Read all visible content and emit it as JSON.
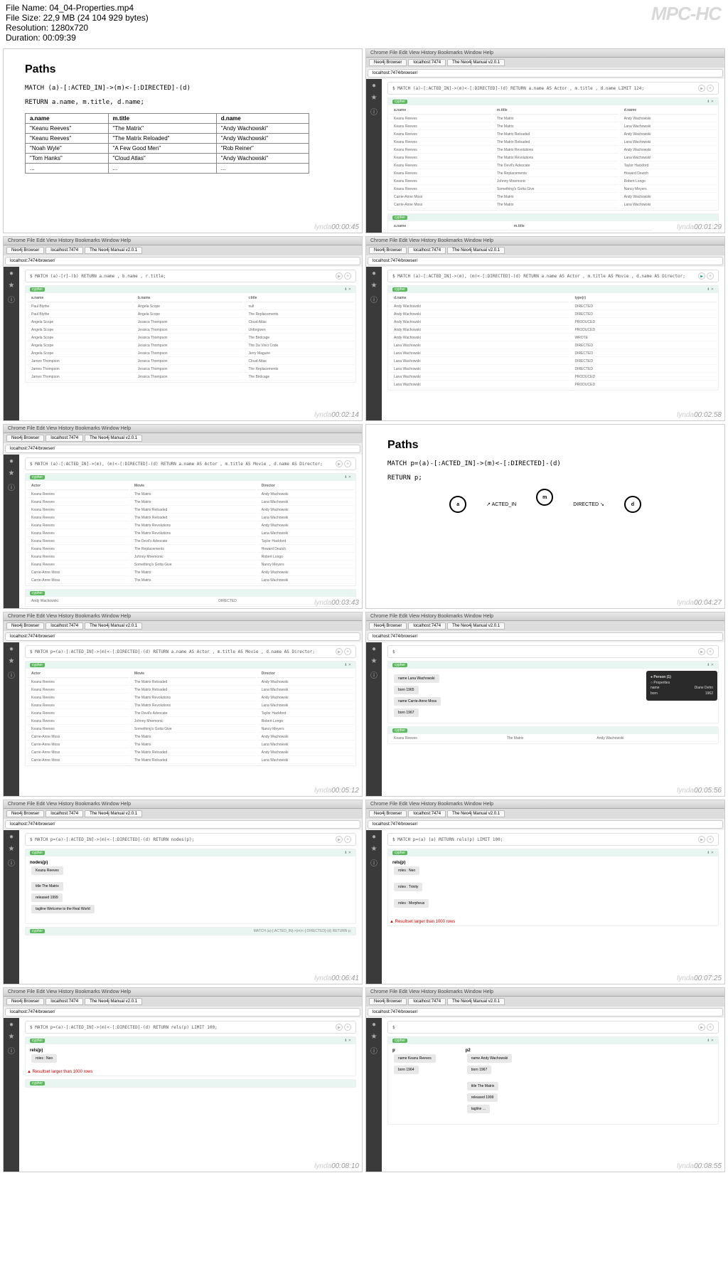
{
  "header": {
    "file": "File Name: 04_04-Properties.mp4",
    "size": "File Size: 22,9 MB (24 104 929 bytes)",
    "res": "Resolution: 1280x720",
    "dur": "Duration: 00:09:39",
    "mpc": "MPC-HC"
  },
  "menu": "Chrome  File  Edit  View  History  Bookmarks  Window  Help",
  "tabs": [
    "Neo4j Browser",
    "localhost:7474",
    "The Neo4j Manual v2.0.1"
  ],
  "url": "localhost:7474/browser/",
  "lynda": "lynda",
  "slide1": {
    "title": "Paths",
    "code1": "MATCH (a)-[:ACTED_IN]->(m)<-[:DIRECTED]-(d)",
    "code2": "RETURN a.name, m.title, d.name;",
    "headers": [
      "a.name",
      "m.title",
      "d.name"
    ],
    "rows": [
      [
        "\"Keanu Reeves\"",
        "\"The Matrix\"",
        "\"Andy Wachowski\""
      ],
      [
        "\"Keanu Reeves\"",
        "\"The Matrix Reloaded\"",
        "\"Andy Wachowski\""
      ],
      [
        "\"Noah Wyle\"",
        "\"A Few Good Men\"",
        "\"Rob Reiner\""
      ],
      [
        "\"Tom Hanks\"",
        "\"Cloud Atlas\"",
        "\"Andy Wachowski\""
      ],
      [
        "...",
        "...",
        "..."
      ]
    ]
  },
  "slide6": {
    "title": "Paths",
    "code1": "MATCH p=(a)-[:ACTED_IN]->(m)<-[:DIRECTED]-(d)",
    "code2": "RETURN p;",
    "nodes": [
      "a",
      "m",
      "d"
    ],
    "edges": [
      "ACTED_IN",
      "DIRECTED"
    ]
  },
  "q2": "$ MATCH (a)-[:ACTED_IN]->(m)<-[:DIRECTED]-(d) RETURN a.name AS Actor , m.title , d.name LIMIT 124;",
  "q3": "$ MATCH (a)-[r]-(b) RETURN a.name , b.name , r.title;",
  "q4": "$ MATCH (a)-[:ACTED_IN]->(m), (m)<-[:DIRECTED]-(d) RETURN a.name AS Actor , m.title AS Movie , d.name AS Director;",
  "q5": "$ MATCH (a)-[:ACTED_IN]->(m), (m)<-[:DIRECTED]-(d) RETURN a.name AS Actor , m.title AS Movie , d.name AS Director;",
  "q7": "$ MATCH p=(a)-[:ACTED_IN]->(m)<-[:DIRECTED]-(d) RETURN a.name AS Actor , m.title AS Movie , d.name AS Director;",
  "q8": "$",
  "q9": "$ MATCH p=(a)-[:ACTED_IN]->(m)<-[:DIRECTED]-(d) RETURN nodes(p);",
  "q10": "$ MATCH p=(a)   (a)  RETURN rels(p) LIMIT 100;",
  "q11": "$ MATCH p=(a)-[:ACTED_IN]->(m)<-[:DIRECTED]-(d) RETURN rels(p) LIMIT 100;",
  "q12": "$",
  "r2h": [
    "a.name",
    "m.title",
    "d.name"
  ],
  "r2": [
    [
      "Keanu Reeves",
      "The Matrix",
      "Andy Wachowski"
    ],
    [
      "Keanu Reeves",
      "The Matrix",
      "Lana Wachowski"
    ],
    [
      "Keanu Reeves",
      "The Matrix Reloaded",
      "Andy Wachowski"
    ],
    [
      "Keanu Reeves",
      "The Matrix Reloaded",
      "Lana Wachowski"
    ],
    [
      "Keanu Reeves",
      "The Matrix Revolutions",
      "Andy Wachowski"
    ],
    [
      "Keanu Reeves",
      "The Matrix Revolutions",
      "Lana Wachowski"
    ],
    [
      "Keanu Reeves",
      "The Devil's Advocate",
      "Taylor Hackford"
    ],
    [
      "Keanu Reeves",
      "The Replacements",
      "Howard Deutch"
    ],
    [
      "Keanu Reeves",
      "Johnny Mnemonic",
      "Robert Longo"
    ],
    [
      "Keanu Reeves",
      "Something's Gotta Give",
      "Nancy Meyers"
    ],
    [
      "Carrie-Anne Moss",
      "The Matrix",
      "Andy Wachowski"
    ],
    [
      "Carrie-Anne Moss",
      "The Matrix",
      "Lana Wachowski"
    ]
  ],
  "r3h": [
    "a.name",
    "b.name",
    "r.title"
  ],
  "r3": [
    [
      "Paul Blythe",
      "Angela Scope",
      "null"
    ],
    [
      "Paul Blythe",
      "Angela Scope",
      "The Replacements"
    ],
    [
      "Angela Scope",
      "Jessica Thompson",
      "Cloud Atlas"
    ],
    [
      "Angela Scope",
      "Jessica Thompson",
      "Unforgiven"
    ],
    [
      "Angela Scope",
      "Jessica Thompson",
      "The Birdcage"
    ],
    [
      "Angela Scope",
      "Jessica Thompson",
      "The Da Vinci Code"
    ],
    [
      "Angela Scope",
      "Jessica Thompson",
      "Jerry Maguire"
    ],
    [
      "James Thompson",
      "Jessica Thompson",
      "Cloud Atlas"
    ],
    [
      "James Thompson",
      "Jessica Thompson",
      "The Replacements"
    ],
    [
      "James Thompson",
      "Jessica Thompson",
      "The Birdcage"
    ]
  ],
  "r4h": [
    "d.name",
    "type(r)"
  ],
  "r4": [
    [
      "Andy Wachowski",
      "DIRECTED"
    ],
    [
      "Andy Wachowski",
      "DIRECTED"
    ],
    [
      "Andy Wachowski",
      "PRODUCED"
    ],
    [
      "Andy Wachowski",
      "PRODUCED"
    ],
    [
      "Andy Wachowski",
      "WROTE"
    ],
    [
      "Lana Wachowski",
      "DIRECTED"
    ],
    [
      "Lana Wachowski",
      "DIRECTED"
    ],
    [
      "Lana Wachowski",
      "DIRECTED"
    ],
    [
      "Lana Wachowski",
      "DIRECTED"
    ],
    [
      "Lana Wachowski",
      "PRODUCED"
    ],
    [
      "Lana Wachowski",
      "PRODUCED"
    ]
  ],
  "r5h": [
    "Actor",
    "Movie",
    "Director"
  ],
  "r5": [
    [
      "Keanu Reeves",
      "The Matrix",
      "Andy Wachowski"
    ],
    [
      "Keanu Reeves",
      "The Matrix",
      "Lana Wachowski"
    ],
    [
      "Keanu Reeves",
      "The Matrix Reloaded",
      "Andy Wachowski"
    ],
    [
      "Keanu Reeves",
      "The Matrix Reloaded",
      "Lana Wachowski"
    ],
    [
      "Keanu Reeves",
      "The Matrix Revolutions",
      "Andy Wachowski"
    ],
    [
      "Keanu Reeves",
      "The Matrix Revolutions",
      "Lana Wachowski"
    ],
    [
      "Keanu Reeves",
      "The Devil's Advocate",
      "Taylor Hackford"
    ],
    [
      "Keanu Reeves",
      "The Replacements",
      "Howard Deutch"
    ],
    [
      "Keanu Reeves",
      "Johnny Mnemonic",
      "Robert Longo"
    ],
    [
      "Keanu Reeves",
      "Something's Gotta Give",
      "Nancy Meyers"
    ],
    [
      "Carrie-Anne Moss",
      "The Matrix",
      "Andy Wachowski"
    ],
    [
      "Carrie-Anne Moss",
      "The Matrix",
      "Lana Wachowski"
    ]
  ],
  "r7": [
    [
      "Keanu Reeves",
      "The Matrix Reloaded",
      "Andy Wachowski"
    ],
    [
      "Keanu Reeves",
      "The Matrix Reloaded",
      "Lana Wachowski"
    ],
    [
      "Keanu Reeves",
      "The Matrix Revolutions",
      "Andy Wachowski"
    ],
    [
      "Keanu Reeves",
      "The Matrix Revolutions",
      "Lana Wachowski"
    ],
    [
      "Keanu Reeves",
      "The Devil's Advocate",
      "Taylor Hackford"
    ],
    [
      "Keanu Reeves",
      "Johnny Mnemonic",
      "Robert Longo"
    ],
    [
      "Keanu Reeves",
      "Something's Gotta Give",
      "Nancy Meyers"
    ],
    [
      "Carrie-Anne Moss",
      "The Matrix",
      "Andy Wachowski"
    ],
    [
      "Carrie-Anne Moss",
      "The Matrix",
      "Lana Wachowski"
    ],
    [
      "Carrie-Anne Moss",
      "The Matrix Reloaded",
      "Andy Wachowski"
    ],
    [
      "Carrie-Anne Moss",
      "The Matrix Reloaded",
      "Lana Wachowski"
    ]
  ],
  "r8": [
    {
      "l": "name",
      "v": "Lana Wachowski"
    },
    {
      "l": "born",
      "v": "1965"
    },
    {
      "l": "name",
      "v": "Carrie-Anne Moss"
    },
    {
      "l": "born",
      "v": "1967"
    }
  ],
  "r9": {
    "hdr": "nodes(p)",
    "boxes": [
      "Keanu Reeves",
      "The Matrix"
    ],
    "props": [
      {
        "l": "title",
        "v": "The Matrix"
      },
      {
        "l": "released",
        "v": "1999"
      },
      {
        "l": "tagline",
        "v": "Welcome to the Real World"
      }
    ]
  },
  "r10": {
    "hdr": "rels(p)",
    "items": [
      "roles : Neo",
      "roles : Trinity",
      "roles : Morpheus"
    ]
  },
  "r11": {
    "hdr": "rels(p)",
    "items": [
      "roles : Neo"
    ],
    "err": "▲ Resultset larger than 1000 rows"
  },
  "r12": {
    "h": [
      "p",
      "p2"
    ],
    "boxes": [
      [
        "name",
        "Keanu Reeves",
        "born",
        "1964"
      ],
      [
        "name",
        "Andy Wachowski",
        "born",
        "1967"
      ],
      [
        "title",
        "The Matrix",
        "released",
        "1999",
        "tagline",
        "..."
      ]
    ]
  },
  "tooltip": {
    "title": "● Person (1)",
    "prop": "○ Properties",
    "rows": [
      [
        "name",
        "Diane Dehn"
      ],
      [
        "born",
        "1962"
      ]
    ]
  },
  "ts": [
    "00:00:45",
    "00:01:29",
    "00:02:14",
    "00:02:58",
    "00:03:43",
    "00:04:27",
    "00:05:12",
    "00:05:56",
    "00:06:41",
    "00:07:25",
    "00:08:10",
    "00:08:55"
  ],
  "old": {
    "h": [
      "a.name",
      "m.title"
    ],
    "r": [
      "Paul Blythe",
      "Keanu Reeves",
      "null"
    ]
  },
  "botq": "MATCH (a)-[:ACTED_IN]->(m)<-[:DIRECTED]-(d) RETURN p;",
  "dir_col": "DIRECTED",
  "dir_val": "Andy Wachowski"
}
